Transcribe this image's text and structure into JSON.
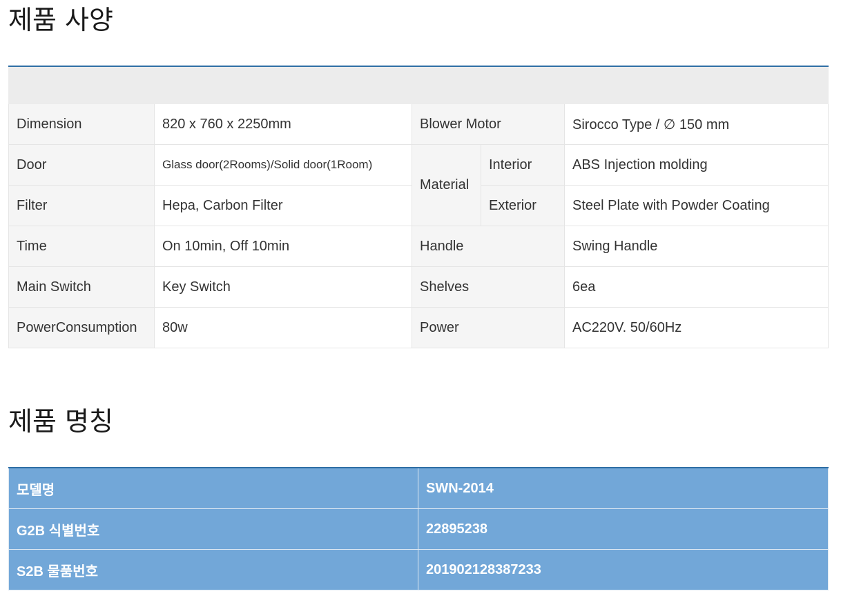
{
  "spec": {
    "title": "제품 사양",
    "rows": [
      {
        "k1": "Dimension",
        "v1": "820 x 760 x 2250mm",
        "k2": "Blower Motor",
        "v2": "Sirocco Type / ∅ 150 mm"
      },
      {
        "k1": "Door",
        "v1": "Glass door(2Rooms)/Solid door(1Room)",
        "k2": "Material",
        "k2sub": "Interior",
        "v2": "ABS Injection molding"
      },
      {
        "k1": "Filter",
        "v1": "Hepa, Carbon Filter",
        "k2sub": "Exterior",
        "v2": "Steel Plate with Powder Coating"
      },
      {
        "k1": "Time",
        "v1": "On 10min, Off 10min",
        "k2": "Handle",
        "v2": "Swing Handle"
      },
      {
        "k1": "Main Switch",
        "v1": "Key Switch",
        "k2": "Shelves",
        "v2": "6ea"
      },
      {
        "k1": "PowerConsumption",
        "v1": "80w",
        "k2": "Power",
        "v2": "AC220V. 50/60Hz"
      }
    ]
  },
  "names": {
    "title": "제품 명칭",
    "rows": [
      {
        "label": "모델명",
        "value": "SWN-2014"
      },
      {
        "label": "G2B 식별번호",
        "value": "22895238"
      },
      {
        "label": "S2B 물품번호",
        "value": "201902128387233"
      }
    ]
  }
}
